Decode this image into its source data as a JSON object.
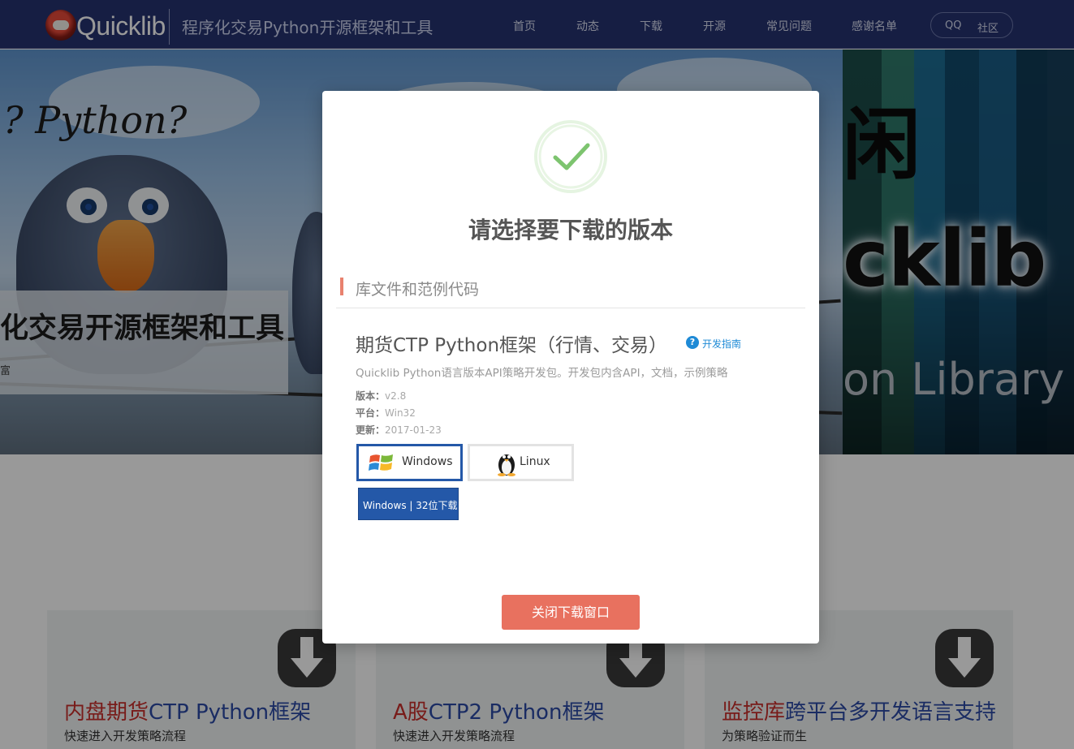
{
  "header": {
    "logo_text": "Quicklib",
    "slogan": "程序化交易Python开源框架和工具",
    "nav": [
      "首页",
      "动态",
      "下载",
      "开源",
      "常见问题",
      "感谢名单"
    ],
    "qq_label": "QQ",
    "community_label": "社区"
  },
  "hero": {
    "python_text": "? Python?",
    "caption_title": "化交易开源框架和工具",
    "caption_sub": "富",
    "right_glyph": "闲",
    "right_big_text": "cklib",
    "right_library_text": "on Library"
  },
  "cards": [
    {
      "title_red": "内盘期货",
      "title_blue": "CTP Python框架",
      "desc": "快速进入开发策略流程",
      "icon": "download-arrow-icon"
    },
    {
      "title_red": "A股",
      "title_blue": "CTP2 Python框架",
      "desc": "快速进入开发策略流程",
      "icon": "download-arrow-icon"
    },
    {
      "title_red": "监控库",
      "title_blue": "跨平台多开发语言支持",
      "desc": "为策略验证而生",
      "icon": "download-arrow-icon"
    }
  ],
  "modal": {
    "icon": "check-circle-icon",
    "title": "请选择要下载的版本",
    "section_label": "库文件和范例代码",
    "product_title": "期货CTP Python框架（行情、交易）",
    "guide_label": "开发指南",
    "description": "Quicklib Python语言版本API策略开发包。开发包内含API，文档，示例策略",
    "version_label": "版本：",
    "version_value": "v2.8",
    "platform_label": "平台：",
    "platform_value": "Win32",
    "updated_label": "更新：",
    "updated_value": "2017-01-23",
    "os_options": [
      {
        "label": "Windows",
        "icon": "windows-logo-icon",
        "selected": true
      },
      {
        "label": "Linux",
        "icon": "linux-tux-icon",
        "selected": false
      }
    ],
    "download_label": "Windows | 32位下载",
    "close_label": "关闭下载窗口"
  },
  "colors": {
    "nav_bg": "#253370",
    "accent_blue": "#2458a8",
    "close_button": "#e8715f",
    "section_marker": "#e8816e",
    "success_green": "#7dc46f",
    "card_red": "#c9302c",
    "card_blue": "#2c4aa6"
  }
}
